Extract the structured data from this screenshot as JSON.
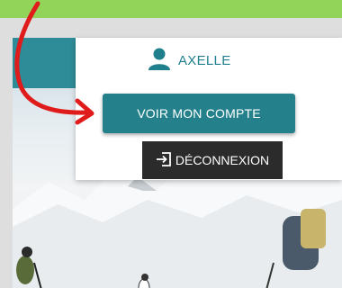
{
  "user": {
    "name": "AXELLE",
    "icon": "user-icon"
  },
  "menu": {
    "account_label": "VOIR MON COMPTE",
    "logout_label": "DÉCONNEXION",
    "logout_icon": "logout-icon"
  },
  "colors": {
    "banner_green": "#92d35a",
    "teal": "#24818c",
    "user_text": "#1f7f8c",
    "logout_bg": "#2b2b2b",
    "arrow_red": "#e01b1b"
  }
}
